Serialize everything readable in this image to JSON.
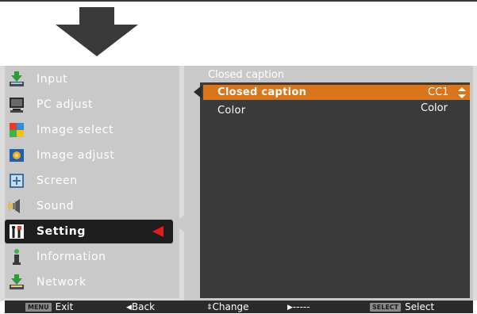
{
  "menu": {
    "items": [
      {
        "label": "Input",
        "icon": "input-icon"
      },
      {
        "label": "PC adjust",
        "icon": "pc-adjust-icon"
      },
      {
        "label": "Image select",
        "icon": "image-select-icon"
      },
      {
        "label": "Image adjust",
        "icon": "image-adjust-icon"
      },
      {
        "label": "Screen",
        "icon": "screen-icon"
      },
      {
        "label": "Sound",
        "icon": "sound-icon"
      },
      {
        "label": "Setting",
        "icon": "setting-icon",
        "active": true
      },
      {
        "label": "Information",
        "icon": "information-icon"
      },
      {
        "label": "Network",
        "icon": "network-icon"
      }
    ]
  },
  "panel": {
    "title": "Closed caption",
    "rows": [
      {
        "label": "Closed caption",
        "value": "CC1",
        "selected": true
      },
      {
        "label": "Color",
        "value": "Color",
        "selected": false
      }
    ]
  },
  "status_bar": {
    "exit_key": "MENU",
    "exit_label": "Exit",
    "back_label": "Back",
    "change_label": "Change",
    "next_label": "-----",
    "select_key": "SELECT",
    "select_label": "Select"
  },
  "colors": {
    "highlight": "#d9761c",
    "active_marker": "#e21b1b",
    "panel_dark": "#3a3a3a",
    "menu_bg": "#c9c9c9"
  }
}
